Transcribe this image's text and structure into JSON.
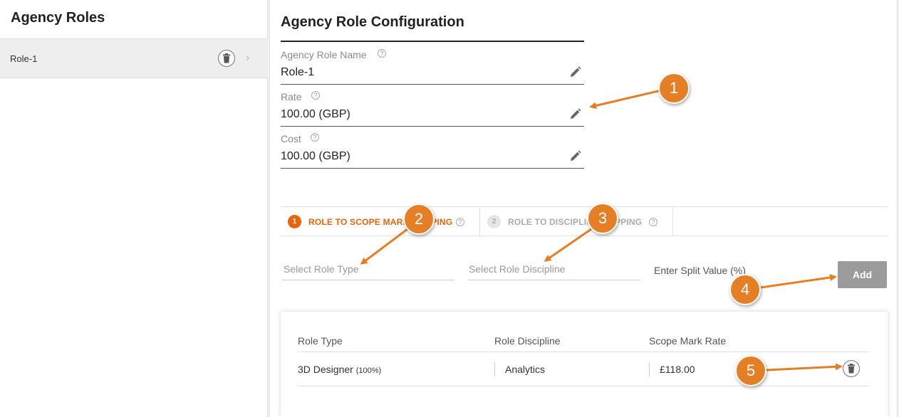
{
  "sidebar": {
    "title": "Agency Roles",
    "items": [
      {
        "label": "Role-1"
      }
    ]
  },
  "main": {
    "title": "Agency Role Configuration",
    "fields": [
      {
        "label": "Agency Role Name",
        "value": "Role-1"
      },
      {
        "label": "Rate",
        "value": "100.00 (GBP)"
      },
      {
        "label": "Cost",
        "value": "100.00 (GBP)"
      }
    ],
    "tabs": [
      {
        "number": "1",
        "label": "ROLE TO SCOPE MARK MAPPING",
        "active": true
      },
      {
        "number": "2",
        "label": "ROLE TO DISCIPLINE MAPPING",
        "active": false
      }
    ],
    "inputs": {
      "role_type_placeholder": "Select Role Type",
      "role_discipline_placeholder": "Select Role Discipline",
      "split_value_placeholder": "Enter Split Value (%)"
    },
    "add_label": "Add",
    "table": {
      "headers": [
        "Role Type",
        "Role Discipline",
        "Scope Mark Rate"
      ],
      "rows": [
        {
          "role_type": "3D Designer",
          "split": "(100%)",
          "discipline": "Analytics",
          "rate": "£118.00"
        }
      ]
    }
  },
  "annotations": [
    "1",
    "2",
    "3",
    "4",
    "5"
  ],
  "colors": {
    "accent": "#e8650a",
    "callout": "#e57f26",
    "add_button": "#9b9b9b"
  },
  "icons": [
    "trash-icon",
    "chevron-right-icon",
    "help-icon",
    "pencil-icon"
  ]
}
